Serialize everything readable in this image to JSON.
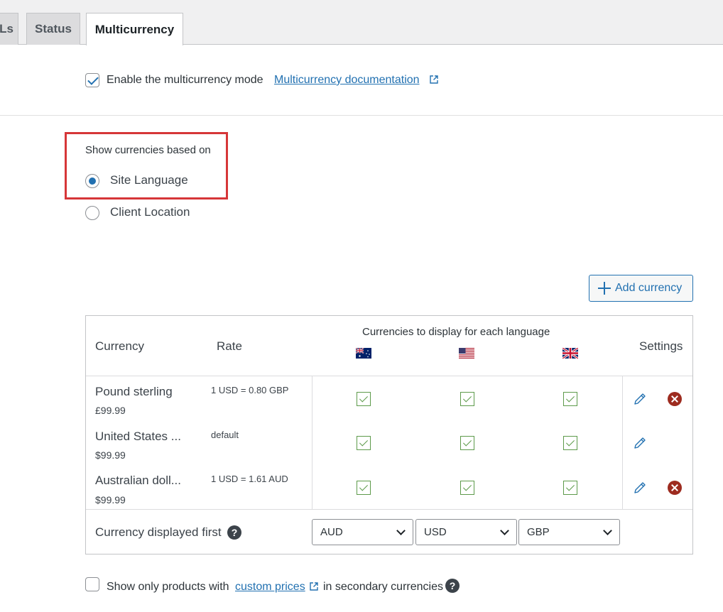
{
  "tabs": [
    {
      "label": "Ls"
    },
    {
      "label": "Status"
    },
    {
      "label": "Multicurrency"
    }
  ],
  "enable": {
    "label": "Enable the multicurrency mode",
    "checked": true,
    "doc_link": "Multicurrency documentation"
  },
  "currency_basis": {
    "heading": "Show currencies based on",
    "options": [
      {
        "label": "Site Language",
        "selected": true
      },
      {
        "label": "Client Location",
        "selected": false
      }
    ]
  },
  "add_button": {
    "label": "Add currency"
  },
  "table": {
    "headers": {
      "currency": "Currency",
      "rate": "Rate",
      "languages": "Currencies to display for each language",
      "settings": "Settings"
    },
    "language_flags": [
      "australia-flag-icon",
      "usa-flag-icon",
      "uk-flag-icon"
    ],
    "rows": [
      {
        "name": "Pound sterling",
        "price": "£99.99",
        "rate": "1 USD = 0.80 GBP",
        "deletable": true
      },
      {
        "name": "United States ...",
        "price": "$99.99",
        "rate": "default",
        "deletable": false
      },
      {
        "name": "Australian doll...",
        "price": "$99.99",
        "rate": "1 USD = 1.61 AUD",
        "deletable": true
      }
    ],
    "first_label": "Currency displayed first",
    "first_selects": [
      "AUD",
      "USD",
      "GBP"
    ]
  },
  "footer": {
    "pre": "Show only products with",
    "link": "custom prices",
    "post": "in secondary currencies"
  },
  "colors": {
    "accent": "#2271b1",
    "highlight": "#d63638",
    "check_green": "#5d9a4a",
    "delete_red": "#9d2b1f"
  }
}
